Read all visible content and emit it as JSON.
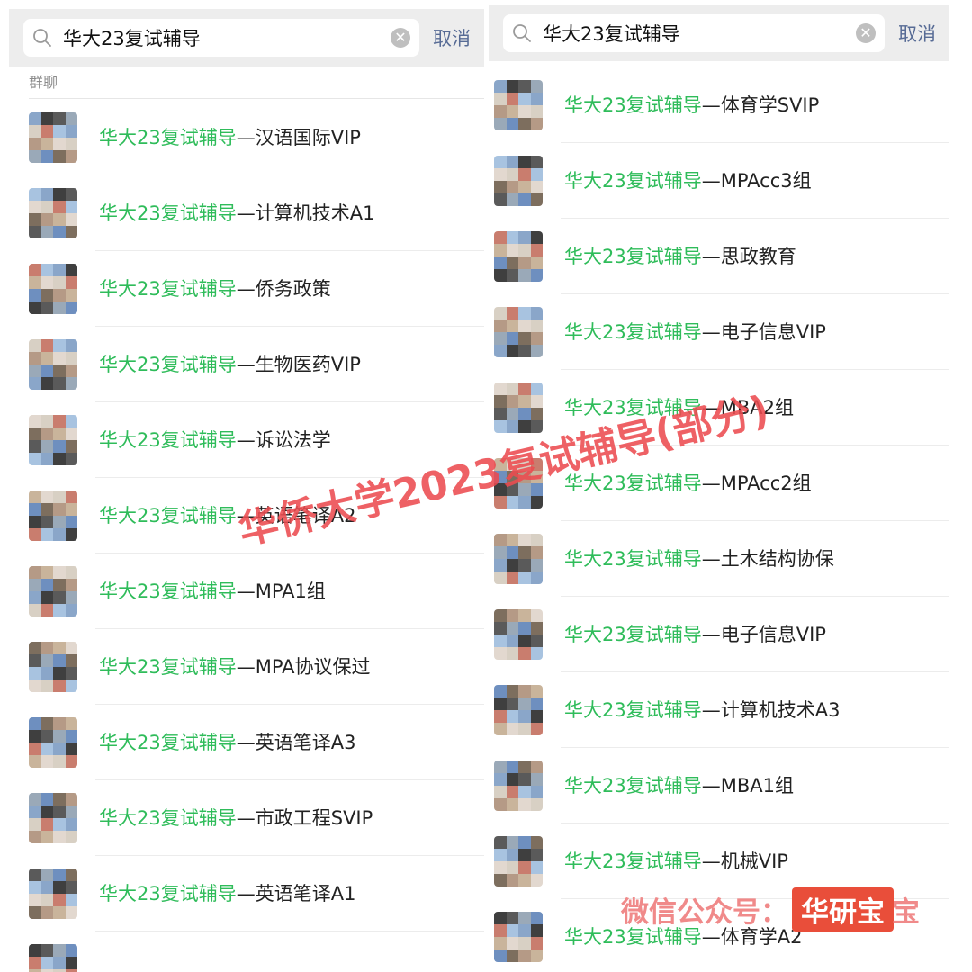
{
  "left_panel": {
    "search": {
      "query": "华大23复试辅导",
      "cancel_label": "取消"
    },
    "section_label": "群聊",
    "groups": [
      {
        "highlight": "华大23复试辅导",
        "rest": "—汉语国际VIP"
      },
      {
        "highlight": "华大23复试辅导",
        "rest": "—计算机技术A1"
      },
      {
        "highlight": "华大23复试辅导",
        "rest": "—侨务政策"
      },
      {
        "highlight": "华大23复试辅导",
        "rest": "—生物医药VIP"
      },
      {
        "highlight": "华大23复试辅导",
        "rest": "—诉讼法学"
      },
      {
        "highlight": "华大23复试辅导",
        "rest": "—英语笔译A2"
      },
      {
        "highlight": "华大23复试辅导",
        "rest": "—MPA1组"
      },
      {
        "highlight": "华大23复试辅导",
        "rest": "—MPA协议保过"
      },
      {
        "highlight": "华大23复试辅导",
        "rest": "—英语笔译A3"
      },
      {
        "highlight": "华大23复试辅导",
        "rest": "—市政工程SVIP"
      },
      {
        "highlight": "华大23复试辅导",
        "rest": "—英语笔译A1"
      },
      {
        "highlight": "",
        "rest": ""
      }
    ]
  },
  "right_panel": {
    "search": {
      "query": "华大23复试辅导",
      "cancel_label": "取消"
    },
    "groups": [
      {
        "highlight": "华大23复试辅导",
        "rest": "—体育学SVIP"
      },
      {
        "highlight": "华大23复试辅导",
        "rest": "—MPAcc3组"
      },
      {
        "highlight": "华大23复试辅导",
        "rest": "—思政教育"
      },
      {
        "highlight": "华大23复试辅导",
        "rest": "—电子信息VIP"
      },
      {
        "highlight": "华大23复试辅导",
        "rest": "—MBA2组"
      },
      {
        "highlight": "华大23复试辅导",
        "rest": "—MPAcc2组"
      },
      {
        "highlight": "华大23复试辅导",
        "rest": "—土木结构协保"
      },
      {
        "highlight": "华大23复试辅导",
        "rest": "—电子信息VIP"
      },
      {
        "highlight": "华大23复试辅导",
        "rest": "—计算机技术A3"
      },
      {
        "highlight": "华大23复试辅导",
        "rest": "—MBA1组"
      },
      {
        "highlight": "华大23复试辅导",
        "rest": "—机械VIP"
      },
      {
        "highlight": "华大23复试辅导",
        "rest": "—体育学A2"
      }
    ]
  },
  "overlay": {
    "watermark": "华侨大学2023复试辅导(部分)",
    "credit_label": "微信公众号：",
    "credit_badge": "华研宝",
    "credit_tail": "宝"
  },
  "colors": {
    "highlight": "#2fbc5a",
    "cancel": "#576b95",
    "watermark": "#ec4b50",
    "badge": "#e94e3a"
  }
}
